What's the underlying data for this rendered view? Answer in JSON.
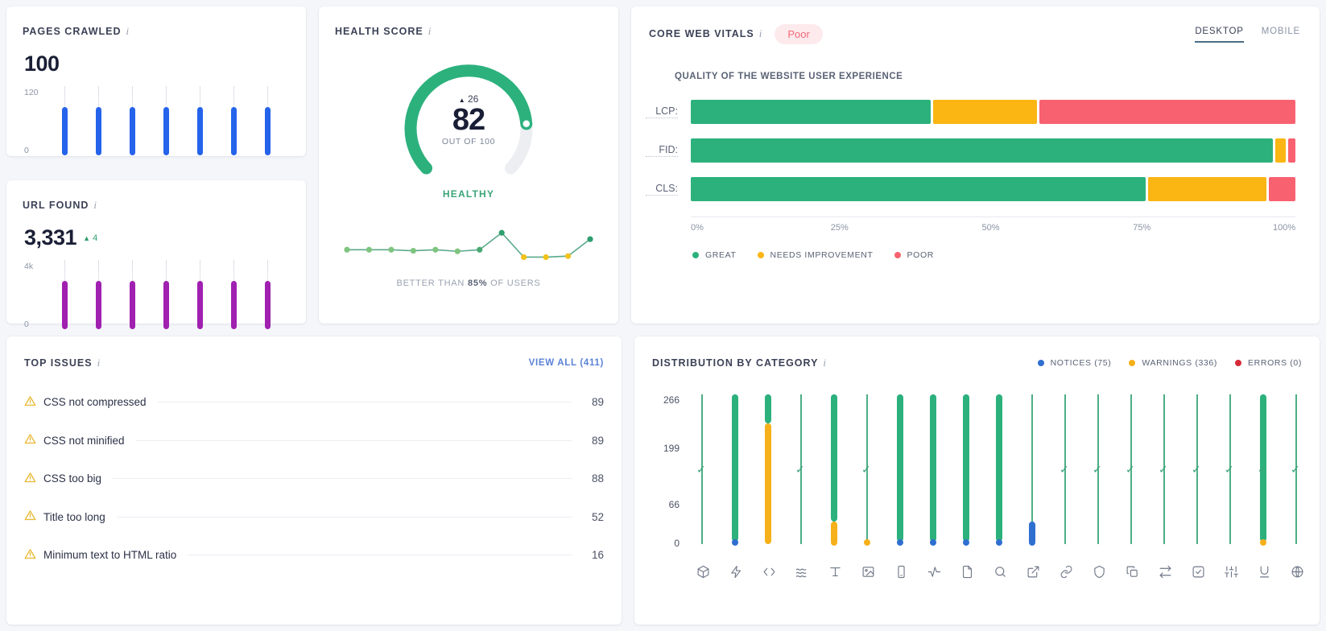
{
  "colors": {
    "great": "#2cb17d",
    "needs_improvement": "#fbb614",
    "poor": "#f8616f",
    "notices": "#2f6fd0",
    "warnings": "#f5b01a",
    "errors": "#d62b3a",
    "pages_bar": "#2563eb",
    "url_bar": "#a020b0",
    "accent_link": "#5b83d6"
  },
  "pages_crawled": {
    "title": "PAGES CRAWLED",
    "value": "100",
    "y_top": "120",
    "y_bottom": "0",
    "bars": [
      100,
      100,
      100,
      100,
      100,
      100,
      100
    ]
  },
  "url_found": {
    "title": "URL FOUND",
    "value": "3,331",
    "delta": "4",
    "delta_dir": "▲",
    "y_top": "4k",
    "y_bottom": "0",
    "bars": [
      100,
      100,
      100,
      100,
      100,
      100,
      100
    ]
  },
  "health_score": {
    "title": "HEALTH SCORE",
    "delta": "26",
    "delta_dir": "▲",
    "score": "82",
    "out_of": "OUT OF 100",
    "status": "HEALTHY",
    "caption_prefix": "BETTER THAN ",
    "caption_value": "85%",
    "caption_suffix": " OF USERS",
    "gauge_percent": 82,
    "sparkline": [
      {
        "v": 30,
        "c": "#7fc47f"
      },
      {
        "v": 30,
        "c": "#7fc47f"
      },
      {
        "v": 30,
        "c": "#7fc47f"
      },
      {
        "v": 28,
        "c": "#7fc47f"
      },
      {
        "v": 30,
        "c": "#7fc47f"
      },
      {
        "v": 27,
        "c": "#7fc47f"
      },
      {
        "v": 30,
        "c": "#4aa873"
      },
      {
        "v": 62,
        "c": "#2f9e6e"
      },
      {
        "v": 16,
        "c": "#f2c21b"
      },
      {
        "v": 16,
        "c": "#f2c21b"
      },
      {
        "v": 18,
        "c": "#f2c21b"
      },
      {
        "v": 50,
        "c": "#2f9e6e"
      }
    ]
  },
  "core_web_vitals": {
    "title": "CORE WEB VITALS",
    "badge": "Poor",
    "tabs": [
      {
        "label": "DESKTOP",
        "active": true
      },
      {
        "label": "MOBILE",
        "active": false
      }
    ],
    "subtitle": "QUALITY OF THE WEBSITE USER EXPERIENCE",
    "axis_ticks": [
      "0%",
      "25%",
      "50%",
      "75%",
      "100%"
    ],
    "legend": [
      {
        "label": "GREAT",
        "color": "#2cb17d"
      },
      {
        "label": "NEEDS IMPROVEMENT",
        "color": "#fbb614"
      },
      {
        "label": "POOR",
        "color": "#f8616f"
      }
    ],
    "rows": [
      {
        "label": "LCP:",
        "segments": [
          {
            "kind": "great",
            "pct": 39.9
          },
          {
            "kind": "ni",
            "pct": 17.5
          },
          {
            "kind": "poor",
            "pct": 42.6
          }
        ]
      },
      {
        "label": "FID:",
        "segments": [
          {
            "kind": "great",
            "pct": 96.5
          },
          {
            "kind": "ni",
            "pct": 2.0
          },
          {
            "kind": "poor",
            "pct": 1.5
          }
        ]
      },
      {
        "label": "CLS:",
        "segments": [
          {
            "kind": "great",
            "pct": 75.5
          },
          {
            "kind": "ni",
            "pct": 19.8
          },
          {
            "kind": "poor",
            "pct": 4.7
          }
        ]
      }
    ]
  },
  "top_issues": {
    "title": "TOP ISSUES",
    "view_all": "VIEW ALL (411)",
    "items": [
      {
        "name": "CSS not compressed",
        "count": "89",
        "severity": "warning"
      },
      {
        "name": "CSS not minified",
        "count": "89",
        "severity": "warning"
      },
      {
        "name": "CSS too big",
        "count": "88",
        "severity": "warning"
      },
      {
        "name": "Title too long",
        "count": "52",
        "severity": "warning"
      },
      {
        "name": "Minimum text to HTML ratio",
        "count": "16",
        "severity": "warning"
      }
    ]
  },
  "distribution": {
    "title": "DISTRIBUTION BY CATEGORY",
    "legend": [
      {
        "label": "NOTICES (75)",
        "color": "#2f6fd0"
      },
      {
        "label": "WARNINGS (336)",
        "color": "#f5b01a"
      },
      {
        "label": "ERRORS (0)",
        "color": "#d62b3a"
      }
    ],
    "y_ticks": [
      "266",
      "199",
      "66",
      "0"
    ],
    "y_max": 266,
    "categories": [
      {
        "icon": "cube-icon",
        "bar_top": 0,
        "bar_bottom": 0,
        "check": true,
        "cap": null
      },
      {
        "icon": "lightning-icon",
        "bar_top": 266,
        "bar_bottom": 4,
        "check": false,
        "cap": "#2f6fd0"
      },
      {
        "icon": "code-icon",
        "bar_top": 266,
        "bar_bottom": 214,
        "check": false,
        "cap": null,
        "second": {
          "color": "#f5b01a",
          "top": 214,
          "bottom": 0
        }
      },
      {
        "icon": "waves-icon",
        "bar_top": 0,
        "bar_bottom": 0,
        "check": true,
        "cap": null
      },
      {
        "icon": "text-icon",
        "bar_top": 266,
        "bar_bottom": 40,
        "check": false,
        "cap": "#f5b01a",
        "second": {
          "color": "#f5b01a",
          "top": 40,
          "bottom": 0
        }
      },
      {
        "icon": "image-icon",
        "bar_top": 0,
        "bar_bottom": 0,
        "check": true,
        "cap": "#f5b01a"
      },
      {
        "icon": "mobile-icon",
        "bar_top": 266,
        "bar_bottom": 4,
        "check": false,
        "cap": "#2f6fd0"
      },
      {
        "icon": "activity-icon",
        "bar_top": 266,
        "bar_bottom": 4,
        "check": false,
        "cap": "#2f6fd0"
      },
      {
        "icon": "document-icon",
        "bar_top": 266,
        "bar_bottom": 4,
        "check": false,
        "cap": "#2f6fd0"
      },
      {
        "icon": "search-icon",
        "bar_top": 266,
        "bar_bottom": 4,
        "check": false,
        "cap": "#2f6fd0"
      },
      {
        "icon": "external-link-icon",
        "bar_top": 40,
        "bar_bottom": 0,
        "check": false,
        "cap": "#2f6fd0",
        "blue": true
      },
      {
        "icon": "link-icon",
        "bar_top": 0,
        "bar_bottom": 0,
        "check": true,
        "cap": null
      },
      {
        "icon": "shield-icon",
        "bar_top": 0,
        "bar_bottom": 0,
        "check": true,
        "cap": null
      },
      {
        "icon": "copy-icon",
        "bar_top": 0,
        "bar_bottom": 0,
        "check": true,
        "cap": null
      },
      {
        "icon": "redirect-icon",
        "bar_top": 0,
        "bar_bottom": 0,
        "check": true,
        "cap": null
      },
      {
        "icon": "checkbox-icon",
        "bar_top": 0,
        "bar_bottom": 0,
        "check": true,
        "cap": null
      },
      {
        "icon": "sliders-icon",
        "bar_top": 0,
        "bar_bottom": 0,
        "check": true,
        "cap": null
      },
      {
        "icon": "underline-icon",
        "bar_top": 266,
        "bar_bottom": 4,
        "check": true,
        "cap": "#f5b01a"
      },
      {
        "icon": "globe-icon",
        "bar_top": 0,
        "bar_bottom": 0,
        "check": true,
        "cap": null
      }
    ]
  },
  "chart_data": [
    {
      "type": "bar",
      "title": "PAGES CRAWLED",
      "categories": [
        "1",
        "2",
        "3",
        "4",
        "5",
        "6",
        "7"
      ],
      "values": [
        100,
        100,
        100,
        100,
        100,
        100,
        100
      ],
      "ylabel": "",
      "xlabel": "",
      "ylim": [
        0,
        120
      ]
    },
    {
      "type": "bar",
      "title": "URL FOUND",
      "categories": [
        "1",
        "2",
        "3",
        "4",
        "5",
        "6",
        "7"
      ],
      "values": [
        3331,
        3331,
        3331,
        3331,
        3331,
        3331,
        3331
      ],
      "ylabel": "",
      "xlabel": "",
      "ylim": [
        0,
        4000
      ]
    },
    {
      "type": "line",
      "title": "Health score history",
      "x": [
        "1",
        "2",
        "3",
        "4",
        "5",
        "6",
        "7",
        "8",
        "9",
        "10",
        "11",
        "12"
      ],
      "values": [
        82,
        82,
        82,
        81,
        82,
        80,
        82,
        95,
        62,
        62,
        64,
        90
      ],
      "ylabel": "",
      "xlabel": ""
    },
    {
      "type": "bar",
      "title": "QUALITY OF THE WEBSITE USER EXPERIENCE",
      "categories": [
        "LCP:",
        "FID:",
        "CLS:"
      ],
      "series": [
        {
          "name": "GREAT",
          "values": [
            39.9,
            96.5,
            75.5
          ]
        },
        {
          "name": "NEEDS IMPROVEMENT",
          "values": [
            17.5,
            2.0,
            19.8
          ]
        },
        {
          "name": "POOR",
          "values": [
            42.6,
            1.5,
            4.7
          ]
        }
      ],
      "xlabel": "",
      "ylabel": "",
      "xlim": [
        0,
        100
      ],
      "ticks": [
        "0%",
        "25%",
        "50%",
        "75%",
        "100%"
      ],
      "legend_position": "bottom-left"
    },
    {
      "type": "bar",
      "title": "DISTRIBUTION BY CATEGORY",
      "categories": [
        "cube",
        "lightning",
        "code",
        "waves",
        "text",
        "image",
        "mobile",
        "activity",
        "document",
        "search",
        "external-link",
        "link",
        "shield",
        "copy",
        "redirect",
        "checkbox",
        "sliders",
        "underline",
        "globe"
      ],
      "series": [
        {
          "name": "NOTICES (75)",
          "values": [
            0,
            4,
            0,
            0,
            0,
            0,
            4,
            4,
            4,
            4,
            40,
            0,
            0,
            0,
            0,
            0,
            0,
            0,
            0
          ]
        },
        {
          "name": "WARNINGS (336)",
          "values": [
            0,
            0,
            214,
            0,
            40,
            4,
            0,
            0,
            0,
            0,
            0,
            0,
            0,
            0,
            0,
            0,
            0,
            4,
            0
          ]
        },
        {
          "name": "ERRORS (0)",
          "values": [
            0,
            0,
            0,
            0,
            0,
            0,
            0,
            0,
            0,
            0,
            0,
            0,
            0,
            0,
            0,
            0,
            0,
            0,
            0
          ]
        }
      ],
      "ylim": [
        0,
        266
      ],
      "yticks": [
        0,
        66,
        199,
        266
      ],
      "legend_position": "top-right"
    }
  ]
}
